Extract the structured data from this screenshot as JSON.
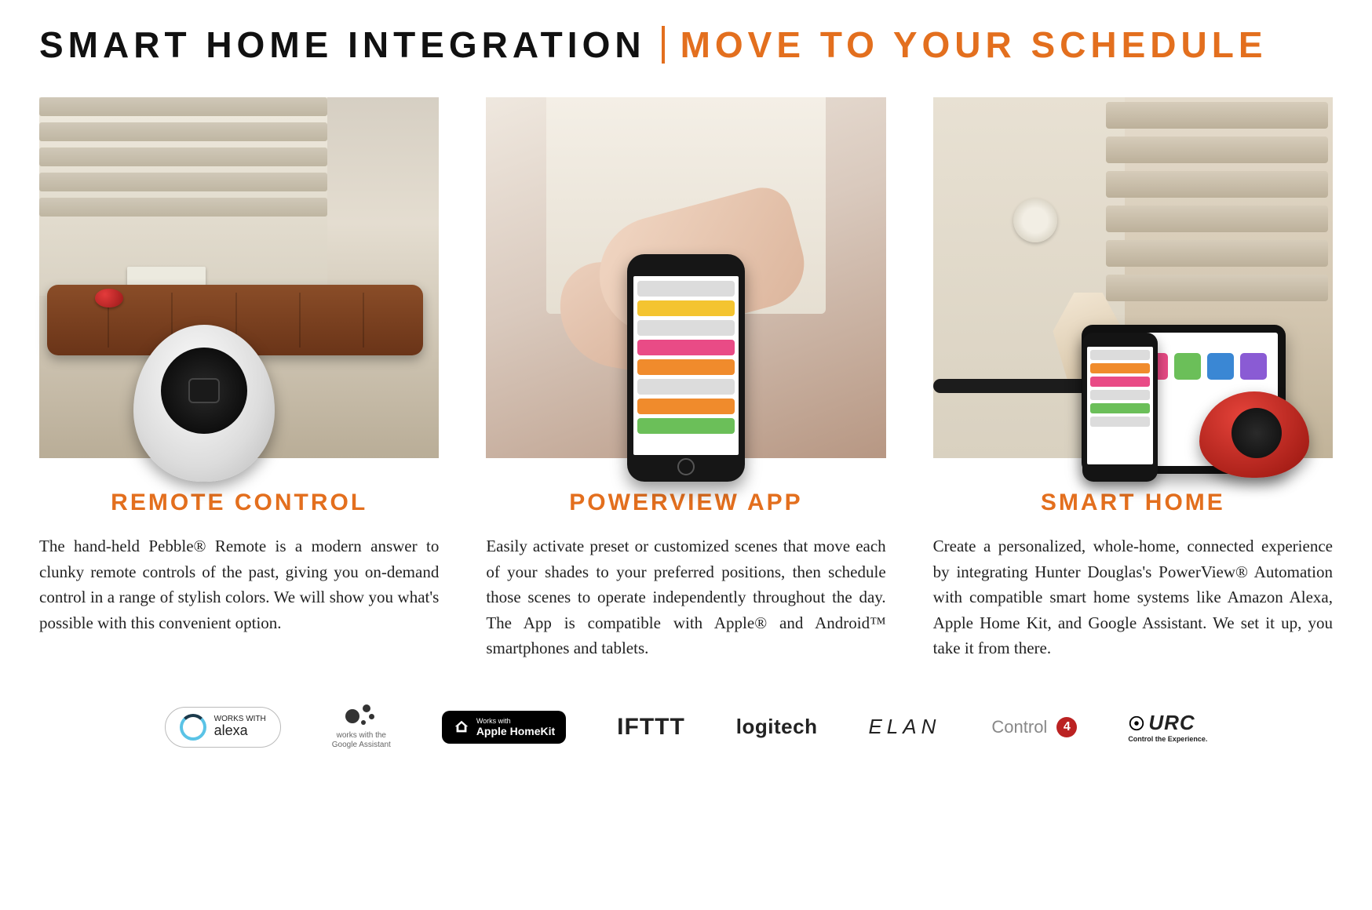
{
  "headline": {
    "left": "SMART HOME INTEGRATION",
    "right": "MOVE TO YOUR SCHEDULE"
  },
  "cards": [
    {
      "title": "REMOTE CONTROL",
      "body": "The hand-held Pebble® Remote is a modern answer to clunky remote controls of the past, giving you on-demand control in a range of stylish colors. We will show you what's possible with this convenient option."
    },
    {
      "title": "POWERVIEW APP",
      "body": "Easily activate preset or customized scenes that move each of your shades to your preferred positions, then schedule those scenes to operate independently throughout the day. The App is compatible with Apple® and Android™ smartphones and tablets."
    },
    {
      "title": "SMART HOME",
      "body": "Create a personalized, whole-home, connected experience by integrating Hunter Douglas's PowerView® Automation with compatible smart home systems like Amazon Alexa, Apple Home Kit, and Google Assistant. We set it up, you take it from there."
    }
  ],
  "logos": {
    "alexa": {
      "line1": "WORKS WITH",
      "line2": "alexa"
    },
    "google_assistant": {
      "line1": "works with the",
      "line2": "Google Assistant"
    },
    "homekit": {
      "line1": "Works with",
      "line2": "Apple HomeKit"
    },
    "ifttt": "IFTTT",
    "logitech": "logitech",
    "elan": "ELAN",
    "control4": {
      "text": "Control",
      "num": "4"
    },
    "urc": {
      "main": "URC",
      "sub": "Control the Experience."
    }
  },
  "colors": {
    "accent": "#e36f1e"
  }
}
